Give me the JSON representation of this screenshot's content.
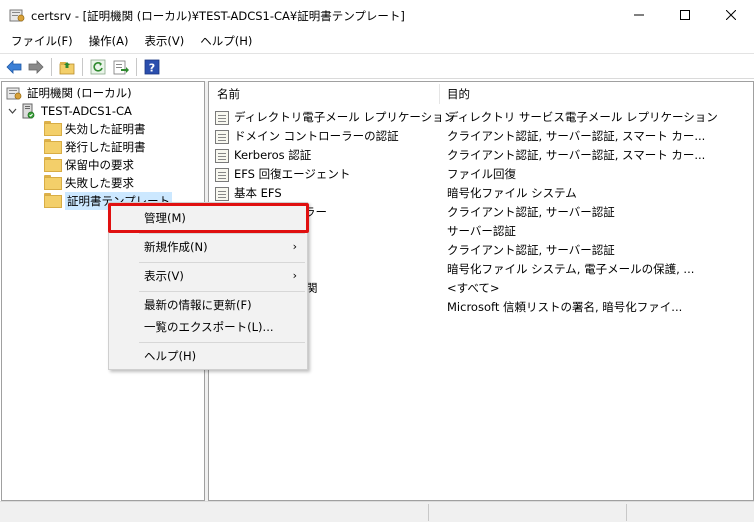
{
  "window": {
    "title": "certsrv - [証明機関 (ローカル)¥TEST-ADCS1-CA¥証明書テンプレート]",
    "minimize_icon": "minimize-icon",
    "maximize_icon": "maximize-icon",
    "close_icon": "close-icon"
  },
  "menubar": {
    "items": [
      "ファイル(F)",
      "操作(A)",
      "表示(V)",
      "ヘルプ(H)"
    ]
  },
  "toolbar": {
    "icons": [
      "back-arrow-icon",
      "forward-arrow-icon",
      "up-folder-icon",
      "refresh-icon",
      "export-list-icon",
      "help-icon"
    ]
  },
  "tree": {
    "root": "証明機関 (ローカル)",
    "ca": "TEST-ADCS1-CA",
    "folders": [
      "失効した証明書",
      "発行した証明書",
      "保留中の要求",
      "失敗した要求",
      "証明書テンプレート"
    ]
  },
  "list": {
    "columns": [
      "名前",
      "目的"
    ],
    "rows": [
      {
        "name": "ディレクトリ電子メール レプリケーション",
        "purpose": "ディレクトリ サービス電子メール レプリケーション"
      },
      {
        "name": "ドメイン コントローラーの認証",
        "purpose": "クライアント認証, サーバー認証, スマート カー..."
      },
      {
        "name": "Kerberos 認証",
        "purpose": "クライアント認証, サーバー認証, スマート カー..."
      },
      {
        "name": "EFS 回復エージェント",
        "purpose": "ファイル回復"
      },
      {
        "name": "基本 EFS",
        "purpose": "暗号化ファイル システム"
      },
      {
        "name": "ラー",
        "purpose": "クライアント認証, サーバー認証"
      },
      {
        "name": "",
        "purpose": "サーバー認証"
      },
      {
        "name": "",
        "purpose": "クライアント認証, サーバー認証"
      },
      {
        "name": "",
        "purpose": "暗号化ファイル システム, 電子メールの保護, ..."
      },
      {
        "name": "関",
        "purpose": "<すべて>"
      },
      {
        "name": "",
        "purpose": "Microsoft 信頼リストの署名, 暗号化ファイ..."
      }
    ]
  },
  "context_menu": {
    "items": [
      {
        "label": "管理(M)",
        "submenu": false
      },
      {
        "label": "新規作成(N)",
        "submenu": true
      },
      {
        "label": "表示(V)",
        "submenu": true
      },
      {
        "label": "最新の情報に更新(F)",
        "submenu": false
      },
      {
        "label": "一覧のエクスポート(L)...",
        "submenu": false
      },
      {
        "label": "ヘルプ(H)",
        "submenu": false
      }
    ],
    "submenu_arrow": "›",
    "highlight_color": "#e01010"
  }
}
